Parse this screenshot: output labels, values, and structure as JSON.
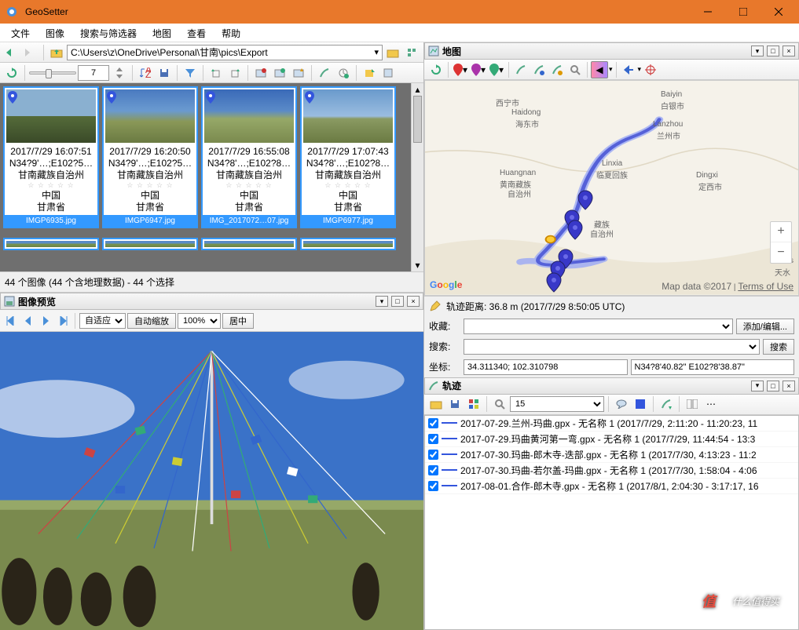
{
  "window": {
    "title": "GeoSetter"
  },
  "menu": {
    "file": "文件",
    "image": "图像",
    "search": "搜索与筛选器",
    "map": "地图",
    "view": "查看",
    "help": "帮助"
  },
  "path": "C:\\Users\\z\\OneDrive\\Personal\\甘南\\pics\\Export",
  "spinner": "7",
  "thumbs": [
    {
      "date": "2017/7/29 16:07:51",
      "coords": "N34?9'…;E102?5…",
      "region": "甘南藏族自治州",
      "country": "中国",
      "province": "甘肃省",
      "name": "IMGP6935.jpg"
    },
    {
      "date": "2017/7/29 16:20:50",
      "coords": "N34?9'…;E102?5…",
      "region": "甘南藏族自治州",
      "country": "中国",
      "province": "甘肃省",
      "name": "IMGP6947.jpg"
    },
    {
      "date": "2017/7/29 16:55:08",
      "coords": "N34?8'…;E102?8…",
      "region": "甘南藏族自治州",
      "country": "中国",
      "province": "甘肃省",
      "name": "IMG_2017072…07.jpg"
    },
    {
      "date": "2017/7/29 17:07:43",
      "coords": "N34?8'…;E102?8…",
      "region": "甘南藏族自治州",
      "country": "中国",
      "province": "甘肃省",
      "name": "IMGP6977.jpg"
    }
  ],
  "status": "44 个图像 (44 个含地理数据) - 44 个选择",
  "preview": {
    "title": "图像预览",
    "fit_label": "自适应",
    "autozoom_label": "自动缩放",
    "zoom": "100%",
    "center_label": "居中"
  },
  "map_panel": {
    "title": "地图"
  },
  "map": {
    "labels": {
      "xining": "西宁市",
      "haidong": "Haidong",
      "haidong_cn": "海东市",
      "lanzhou": "Lanzhou",
      "lanzhou_cn": "兰州市",
      "baiyin": "Baiyin",
      "baiyin_cn": "白银市",
      "linxia": "Linxia",
      "linxia_cn": "临夏回族",
      "dingxi": "Dingxi",
      "dingxi_cn": "定西市",
      "huangnan": "Huangnan",
      "huangnan_cn": "黄南藏族",
      "huangnan_cn2": "自治州",
      "gannan_cn": "藏族",
      "gannan_cn2": "自治州",
      "tians": "Tians",
      "tians_cn": "天水"
    },
    "google": "Google",
    "attr": "Map data ©2017",
    "terms": "Terms of Use"
  },
  "track_info": "轨迹距离: 36.8 m (2017/7/29 8:50:05 UTC)",
  "form": {
    "fav_label": "收藏:",
    "fav_btn": "添加/编辑...",
    "search_label": "搜索:",
    "search_btn": "搜索",
    "coord_label": "坐标:",
    "coord_dec": "34.311340; 102.310798",
    "coord_dms": "N34?8'40.82\" E102?8'38.87\""
  },
  "tracks_panel": {
    "title": "轨迹"
  },
  "track_zoom": "15",
  "tracks": [
    "2017-07-29.兰州-玛曲.gpx - 无名称 1 (2017/7/29, 2:11:20 - 11:20:23, 11",
    "2017-07-29.玛曲黄河第一弯.gpx - 无名称 1 (2017/7/29, 11:44:54 - 13:3",
    "2017-07-30.玛曲-郎木寺-迭部.gpx - 无名称 1 (2017/7/30, 4:13:23 - 11:2",
    "2017-07-30.玛曲-若尔盖-玛曲.gpx - 无名称 1 (2017/7/30, 1:58:04 - 4:06",
    "2017-08-01.合作-郎木寺.gpx - 无名称 1 (2017/8/1, 2:04:30 - 3:17:17, 16"
  ],
  "watermark": "什么值得买"
}
